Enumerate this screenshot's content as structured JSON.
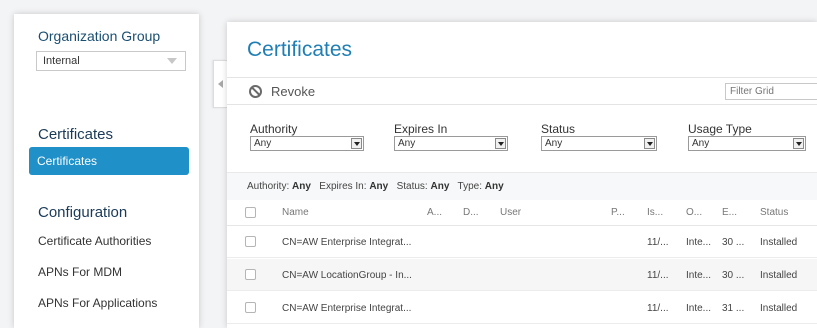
{
  "sidebar": {
    "org_group_title": "Organization Group",
    "org_group_value": "Internal",
    "section_certificates": "Certificates",
    "item_certificates": "Certificates",
    "section_configuration": "Configuration",
    "items": [
      {
        "label": "Certificate Authorities"
      },
      {
        "label": "APNs For MDM"
      },
      {
        "label": "APNs For Applications"
      }
    ]
  },
  "main": {
    "title": "Certificates",
    "toolbar": {
      "revoke_label": "Revoke",
      "filter_placeholder": "Filter Grid"
    },
    "filters": [
      {
        "label": "Authority",
        "value": "Any"
      },
      {
        "label": "Expires In",
        "value": "Any"
      },
      {
        "label": "Status",
        "value": "Any"
      },
      {
        "label": "Usage Type",
        "value": "Any"
      }
    ],
    "summary": {
      "authority_label": "Authority:",
      "authority_value": "Any",
      "expires_label": "Expires In:",
      "expires_value": "Any",
      "status_label": "Status:",
      "status_value": "Any",
      "type_label": "Type:",
      "type_value": "Any"
    },
    "grid": {
      "columns": [
        "Name",
        "A...",
        "D...",
        "User",
        "P...",
        "Is...",
        "O...",
        "E...",
        "Status"
      ],
      "rows": [
        {
          "name": "CN=AW Enterprise Integrat...",
          "issued": "11/...",
          "org": "Inte...",
          "expires": "30 ...",
          "status": "Installed"
        },
        {
          "name": "CN=AW LocationGroup - In...",
          "issued": "11/...",
          "org": "Inte...",
          "expires": "30 ...",
          "status": "Installed"
        },
        {
          "name": "CN=AW Enterprise Integrat...",
          "issued": "11/...",
          "org": "Inte...",
          "expires": "31 ...",
          "status": "Installed"
        }
      ]
    }
  }
}
